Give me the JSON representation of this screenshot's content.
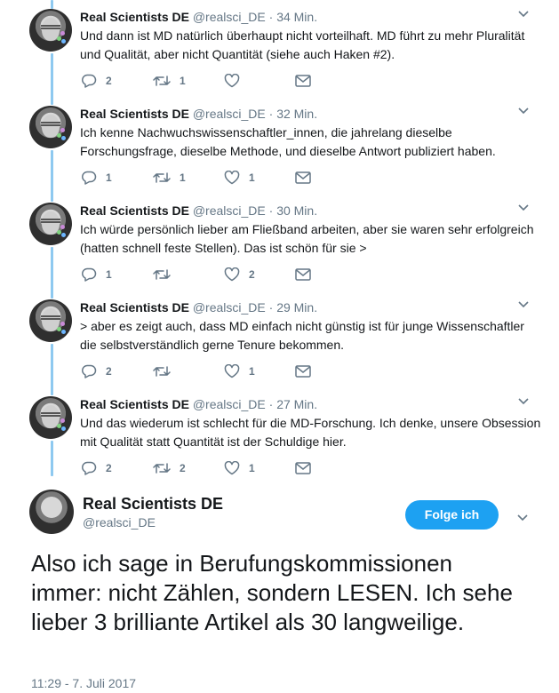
{
  "tweets": [
    {
      "name": "Real Scientists DE",
      "handle": "@realsci_DE",
      "sep": " · ",
      "time": "34 Min.",
      "text": "Und dann ist MD natürlich überhaupt nicht vorteilhaft. MD führt zu mehr Pluralität und Qualität, aber nicht Quantität (siehe auch Haken #2).",
      "replies": "2",
      "retweets": "1",
      "likes": ""
    },
    {
      "name": "Real Scientists DE",
      "handle": "@realsci_DE",
      "sep": " · ",
      "time": "32 Min.",
      "text": "Ich kenne Nachwuchswissenschaftler_innen, die jahrelang dieselbe Forschungsfrage, dieselbe Methode, und dieselbe Antwort publiziert haben.",
      "replies": "1",
      "retweets": "1",
      "likes": "1"
    },
    {
      "name": "Real Scientists DE",
      "handle": "@realsci_DE",
      "sep": " · ",
      "time": "30 Min.",
      "text": "Ich würde persönlich lieber am Fließband arbeiten, aber sie waren sehr erfolgreich (hatten schnell feste Stellen). Das ist schön für sie >",
      "replies": "1",
      "retweets": "",
      "likes": "2"
    },
    {
      "name": "Real Scientists DE",
      "handle": "@realsci_DE",
      "sep": " · ",
      "time": "29 Min.",
      "text": "> aber es zeigt auch, dass MD einfach nicht günstig ist für junge Wissenschaftler die selbstverständlich gerne Tenure bekommen.",
      "replies": "2",
      "retweets": "",
      "likes": "1"
    },
    {
      "name": "Real Scientists DE",
      "handle": "@realsci_DE",
      "sep": " · ",
      "time": "27 Min.",
      "text": "Und das wiederum ist schlecht für die MD-Forschung. Ich denke, unsere Obsession mit Qualität statt Quantität ist der Schuldige hier.",
      "replies": "2",
      "retweets": "2",
      "likes": "1"
    }
  ],
  "main": {
    "name": "Real Scientists DE",
    "handle": "@realsci_DE",
    "follow_label": "Folge ich",
    "text": "Also ich sage in Berufungskommissionen immer: nicht Zählen, sondern LESEN. Ich sehe lieber 3 brilliante Artikel als 30 langweilige.",
    "timestamp": "11:29 - 7. Juli 2017"
  },
  "colors": {
    "accent": "#1da1f2",
    "thread_line": "#8ec9f0",
    "secondary_text": "#657786"
  },
  "icons": [
    "chevron-down-icon",
    "reply-icon",
    "retweet-icon",
    "like-icon",
    "message-icon"
  ]
}
